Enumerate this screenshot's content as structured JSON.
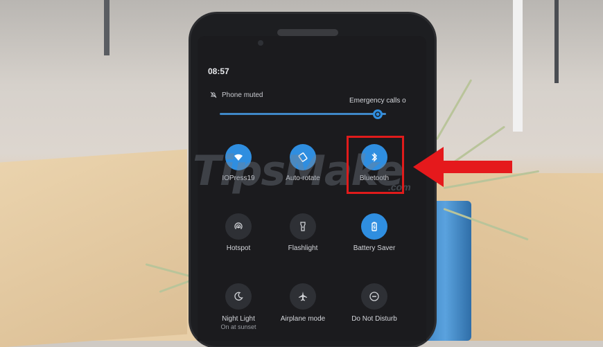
{
  "status_bar": {
    "time": "08:57"
  },
  "notification_header": {
    "mute_label": "Phone muted",
    "emergency_label": "Emergency calls o"
  },
  "brightness": {
    "level": 0.95
  },
  "tiles": [
    {
      "label": "IOPress19",
      "sub": "",
      "icon": "wifi-icon",
      "active": true
    },
    {
      "label": "Auto-rotate",
      "sub": "",
      "icon": "auto-rotate-icon",
      "active": true
    },
    {
      "label": "Bluetooth",
      "sub": "",
      "icon": "bluetooth-icon",
      "active": true
    },
    {
      "label": "Hotspot",
      "sub": "",
      "icon": "hotspot-icon",
      "active": false
    },
    {
      "label": "Flashlight",
      "sub": "",
      "icon": "flashlight-icon",
      "active": false
    },
    {
      "label": "Battery Saver",
      "sub": "",
      "icon": "battery-icon",
      "active": true
    },
    {
      "label": "Night Light",
      "sub": "On at sunset",
      "icon": "moon-icon",
      "active": false
    },
    {
      "label": "Airplane mode",
      "sub": "",
      "icon": "airplane-icon",
      "active": false
    },
    {
      "label": "Do Not Disturb",
      "sub": "",
      "icon": "do-not-disturb-icon",
      "active": false
    }
  ],
  "watermark": {
    "main": "TipsMake",
    "sub": ".com"
  },
  "colors": {
    "accent": "#2f8ee0",
    "highlight": "#e01b1b",
    "arrow": "#e5191c"
  }
}
